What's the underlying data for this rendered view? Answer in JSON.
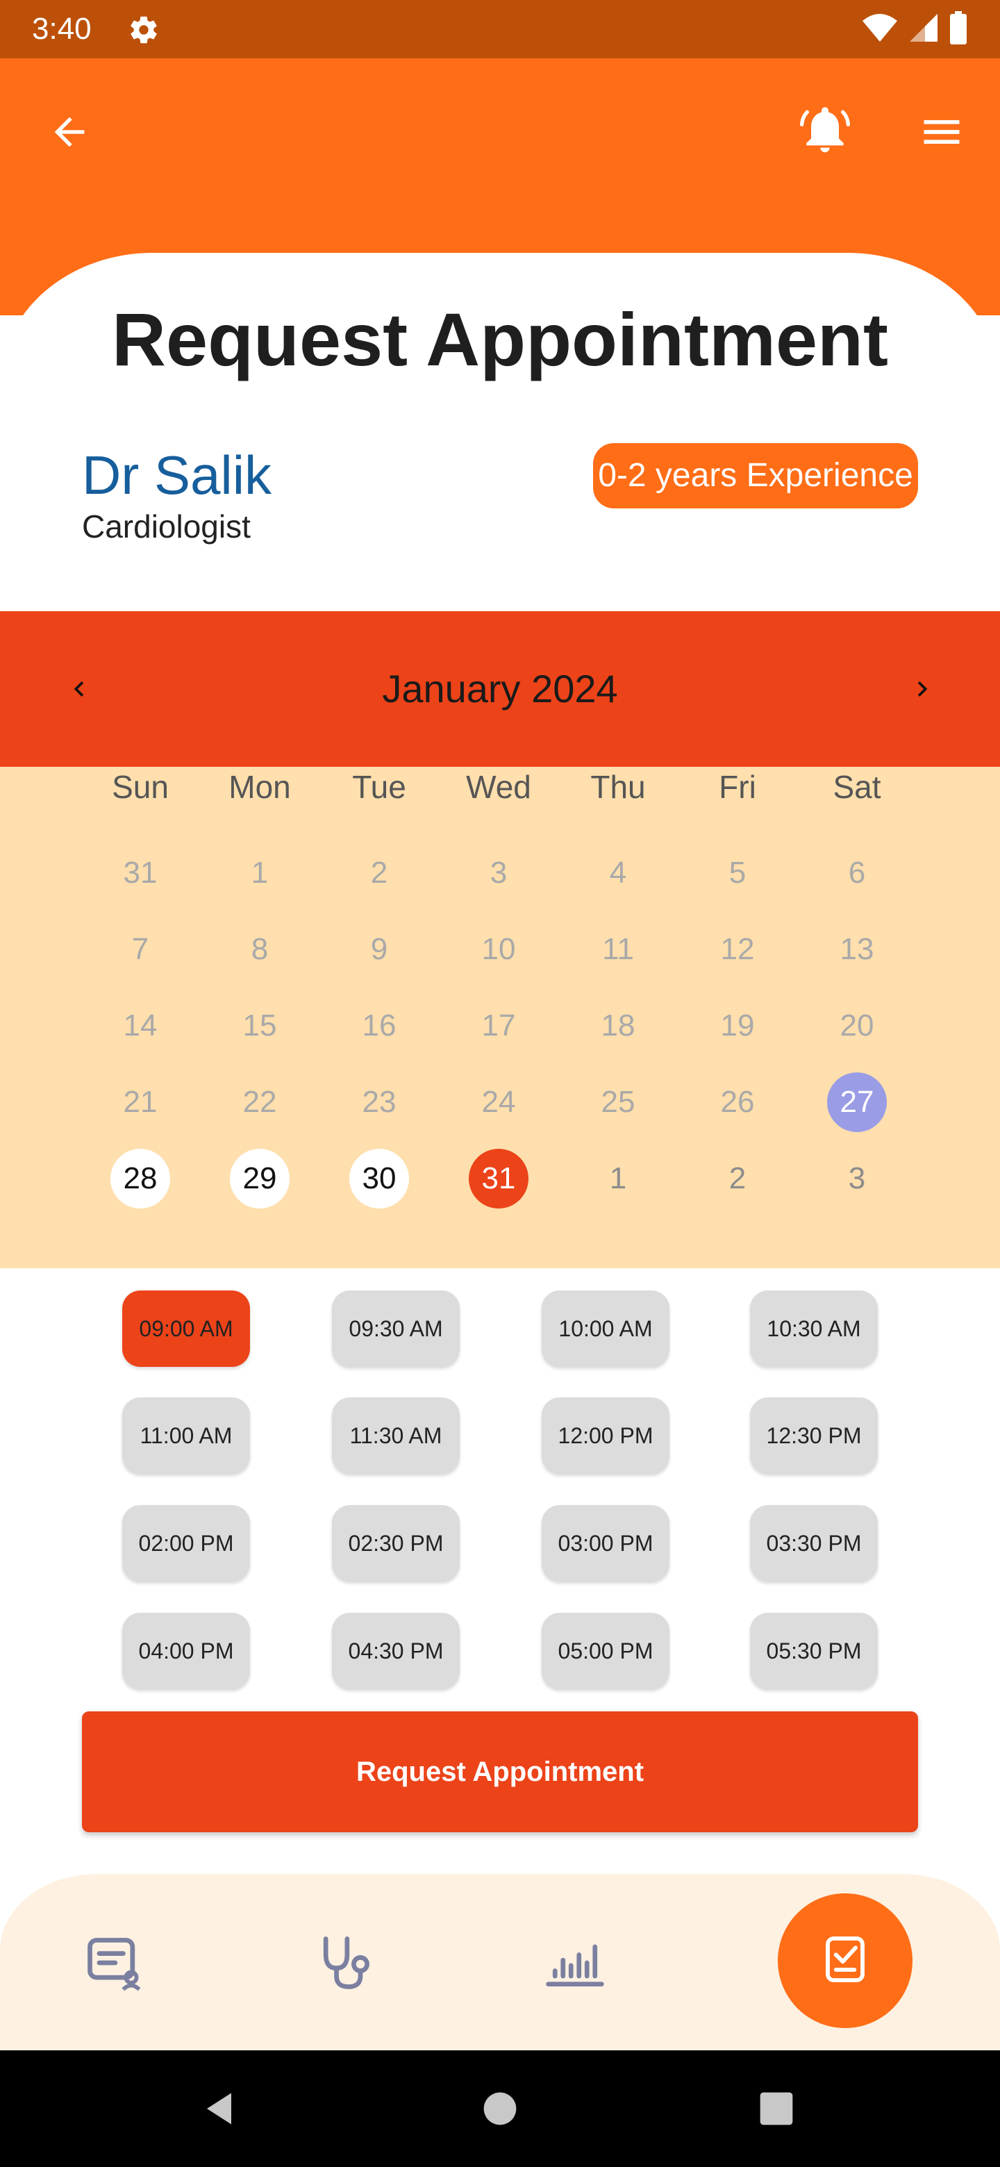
{
  "status_bar": {
    "time": "3:40"
  },
  "header": {
    "title": "Request Appointment"
  },
  "doctor": {
    "name": "Dr Salik",
    "specialty": "Cardiologist",
    "experience_badge": "0-2 years Experience"
  },
  "calendar": {
    "month_label": "January 2024",
    "weekdays": [
      "Sun",
      "Mon",
      "Tue",
      "Wed",
      "Thu",
      "Fri",
      "Sat"
    ],
    "weeks": [
      [
        "31",
        "1",
        "2",
        "3",
        "4",
        "5",
        "6"
      ],
      [
        "7",
        "8",
        "9",
        "10",
        "11",
        "12",
        "13"
      ],
      [
        "14",
        "15",
        "16",
        "17",
        "18",
        "19",
        "20"
      ],
      [
        "21",
        "22",
        "23",
        "24",
        "25",
        "26",
        "27"
      ],
      [
        "28",
        "29",
        "30",
        "31",
        "1",
        "2",
        "3"
      ]
    ],
    "today": "27",
    "selected_date": "31",
    "available_dates": [
      "28",
      "29",
      "30"
    ]
  },
  "time_slots": {
    "selected": "09:00 AM",
    "rows": [
      [
        "09:00 AM",
        "09:30 AM",
        "10:00 AM",
        "10:30 AM"
      ],
      [
        "11:00 AM",
        "11:30 AM",
        "12:00 PM",
        "12:30 PM"
      ],
      [
        "02:00 PM",
        "02:30 PM",
        "03:00 PM",
        "03:30 PM"
      ],
      [
        "04:00 PM",
        "04:30 PM",
        "05:00 PM",
        "05:30 PM"
      ]
    ]
  },
  "cta": {
    "label": "Request Appointment"
  },
  "bottom_nav": {
    "items": [
      "prescription-icon",
      "stethoscope-icon",
      "chart-icon",
      "appointment-icon"
    ],
    "active": "appointment-icon"
  },
  "colors": {
    "status_bar": "#BC5008",
    "app_bar": "#FF6D17",
    "accent_red": "#EC4319",
    "calendar_bg": "#FEDFAD",
    "today_highlight": "#9A9CE6",
    "doctor_name": "#165E9C",
    "nav_bg": "#FEF1E1"
  }
}
